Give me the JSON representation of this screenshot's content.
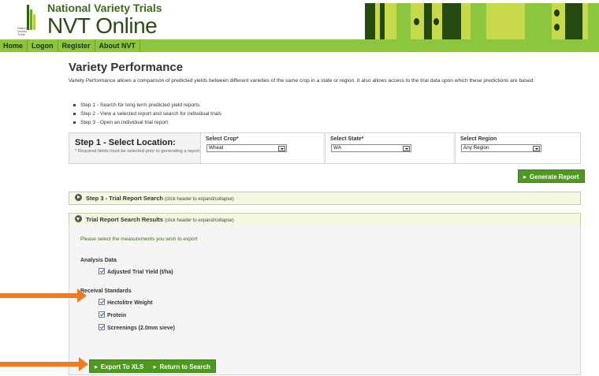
{
  "header": {
    "logo_small_text": "National Variety Trials",
    "brand_top": "National Variety Trials",
    "brand_main": "NVT Online"
  },
  "nav": {
    "items": [
      "Home",
      "Logon",
      "Register",
      "About NVT"
    ]
  },
  "page": {
    "title": "Variety Performance",
    "intro": "Variety Performance allows a comparison of predicted yields between different varieties of the same crop in a state or region. It also allows access to the trial data upon which these predictions are based.",
    "steps": [
      "Step 1 - Search for long term predicted yield reports",
      "Step 2 - View a selected report and search for individual trials",
      "Step 3 - Open an individual trial report"
    ]
  },
  "location": {
    "title": "Step 1 - Select Location:",
    "note": "* Required fields must be selected prior to generating a report.",
    "crop_label": "Select Crop*",
    "crop_value": "Wheat",
    "state_label": "Select State*",
    "state_value": "WA",
    "region_label": "Select Region",
    "region_value": "Any Region",
    "generate_label": "Generate Report"
  },
  "panels": {
    "step3_title": "Step 3 - Trial Report Search",
    "step3_hint": "(click header to expand/collapse)",
    "results_title": "Trial Report Search Results",
    "results_hint": "(click header to expand/collapse)"
  },
  "export": {
    "instruction": "Please select the measurements you wish to export",
    "analysis_heading": "Analysis Data",
    "analysis_items": [
      "Adjusted Trial Yield (t/ha)"
    ],
    "receival_heading": "Receival Standards",
    "receival_items": [
      "Hectolitre Weight",
      "Protein",
      "Screenings (2.0mm sieve)"
    ],
    "export_label": "Export To XLS",
    "return_label": "Return to Search"
  },
  "colors": {
    "nav_green": "#8cc63f",
    "button_green": "#4e9a21",
    "arrow_orange": "#f07b22",
    "brand_dark_green": "#2b4a14"
  }
}
